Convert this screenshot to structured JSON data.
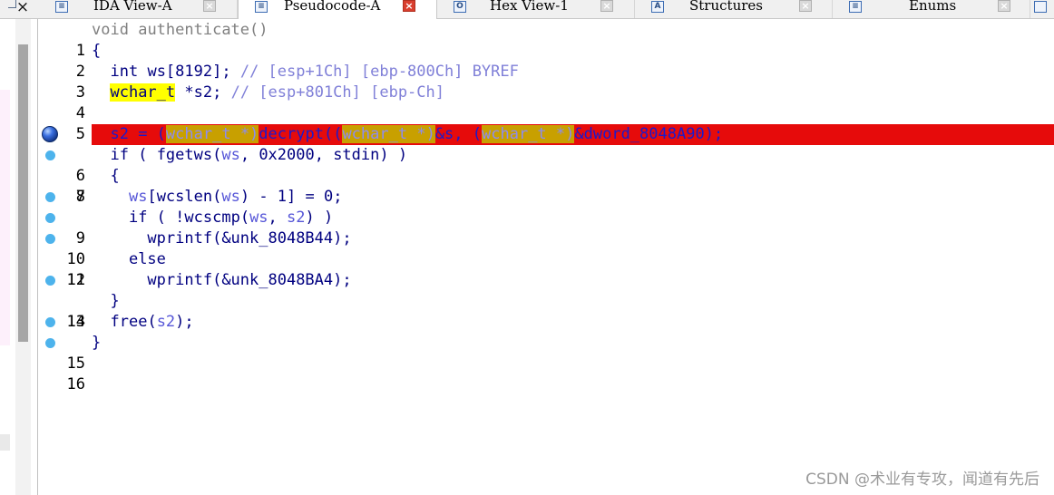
{
  "tabs": [
    {
      "label": "IDA View-A",
      "icon": "disassembly-view-icon",
      "icon_glyph": "≡",
      "active": false
    },
    {
      "label": "Pseudocode-A",
      "icon": "pseudocode-icon",
      "icon_glyph": "≡",
      "active": true
    },
    {
      "label": "Hex View-1",
      "icon": "hex-view-icon",
      "icon_glyph": "O",
      "active": false
    },
    {
      "label": "Structures",
      "icon": "structures-icon",
      "icon_glyph": "A",
      "active": false
    },
    {
      "label": "Enums",
      "icon": "enums-icon",
      "icon_glyph": "≡",
      "active": false
    }
  ],
  "left_close_glyph": "×",
  "tab_close_glyph": "×",
  "code": {
    "line_numbers": [
      "1",
      "2",
      "3",
      "4",
      "5",
      "6",
      "7",
      "8",
      "9",
      "10",
      "11",
      "12",
      "13",
      "14",
      "15",
      "16"
    ],
    "breakpoint_lines": [
      "6",
      "7",
      "9",
      "10",
      "11",
      "13",
      "15",
      "16"
    ],
    "current_line": "6",
    "l1": {
      "kw": "void",
      "fn": "authenticate",
      "rest": "()"
    },
    "l2": {
      "text": "{"
    },
    "l3": {
      "type": "int",
      "decl": "ws[8192];",
      "comment": "// [esp+1Ch] [ebp-800Ch] BYREF"
    },
    "l4": {
      "type": "wchar_t",
      "decl": "*s2;",
      "comment": "// [esp+801Ch] [ebp-Ch]"
    },
    "l6": {
      "var": "s2",
      "assign": " = (",
      "cast_type": "wchar_t",
      "cast_end": " *)",
      "call": "decrypt",
      "open": "((",
      "cast_type2": "wchar_t",
      "cast_end2": " *)",
      "arg1": "&s",
      "sep": ", (",
      "cast_type3": "wchar_t",
      "cast_end3": " *)",
      "arg2": "&dword_8048A90",
      "close": ");"
    },
    "l7": {
      "kw": "if",
      "open": " ( ",
      "fn": "fgetws",
      "p1": "(",
      "a1": "ws",
      "rest": ", 0x2000, stdin) )"
    },
    "l8": {
      "text": "{"
    },
    "l9": {
      "a": "ws",
      "b": "[",
      "fn": "wcslen",
      "c": "(",
      "d": "ws",
      "e": ") - 1] = 0;"
    },
    "l10": {
      "kw": "if",
      "open": " ( !",
      "fn": "wcscmp",
      "p": "(",
      "a": "ws",
      "s": ", ",
      "b": "s2",
      "rest": ") )"
    },
    "l11": {
      "fn": "wprintf",
      "rest": "(&unk_8048B44);"
    },
    "l12": {
      "kw": "else"
    },
    "l13": {
      "fn": "wprintf",
      "rest": "(&unk_8048BA4);"
    },
    "l14": {
      "text": "}"
    },
    "l15": {
      "fn": "free",
      "p": "(",
      "a": "s2",
      "rest": ");"
    },
    "l16": {
      "text": "}"
    }
  },
  "watermark": "CSDN @术业有专攻，闻道有先后"
}
